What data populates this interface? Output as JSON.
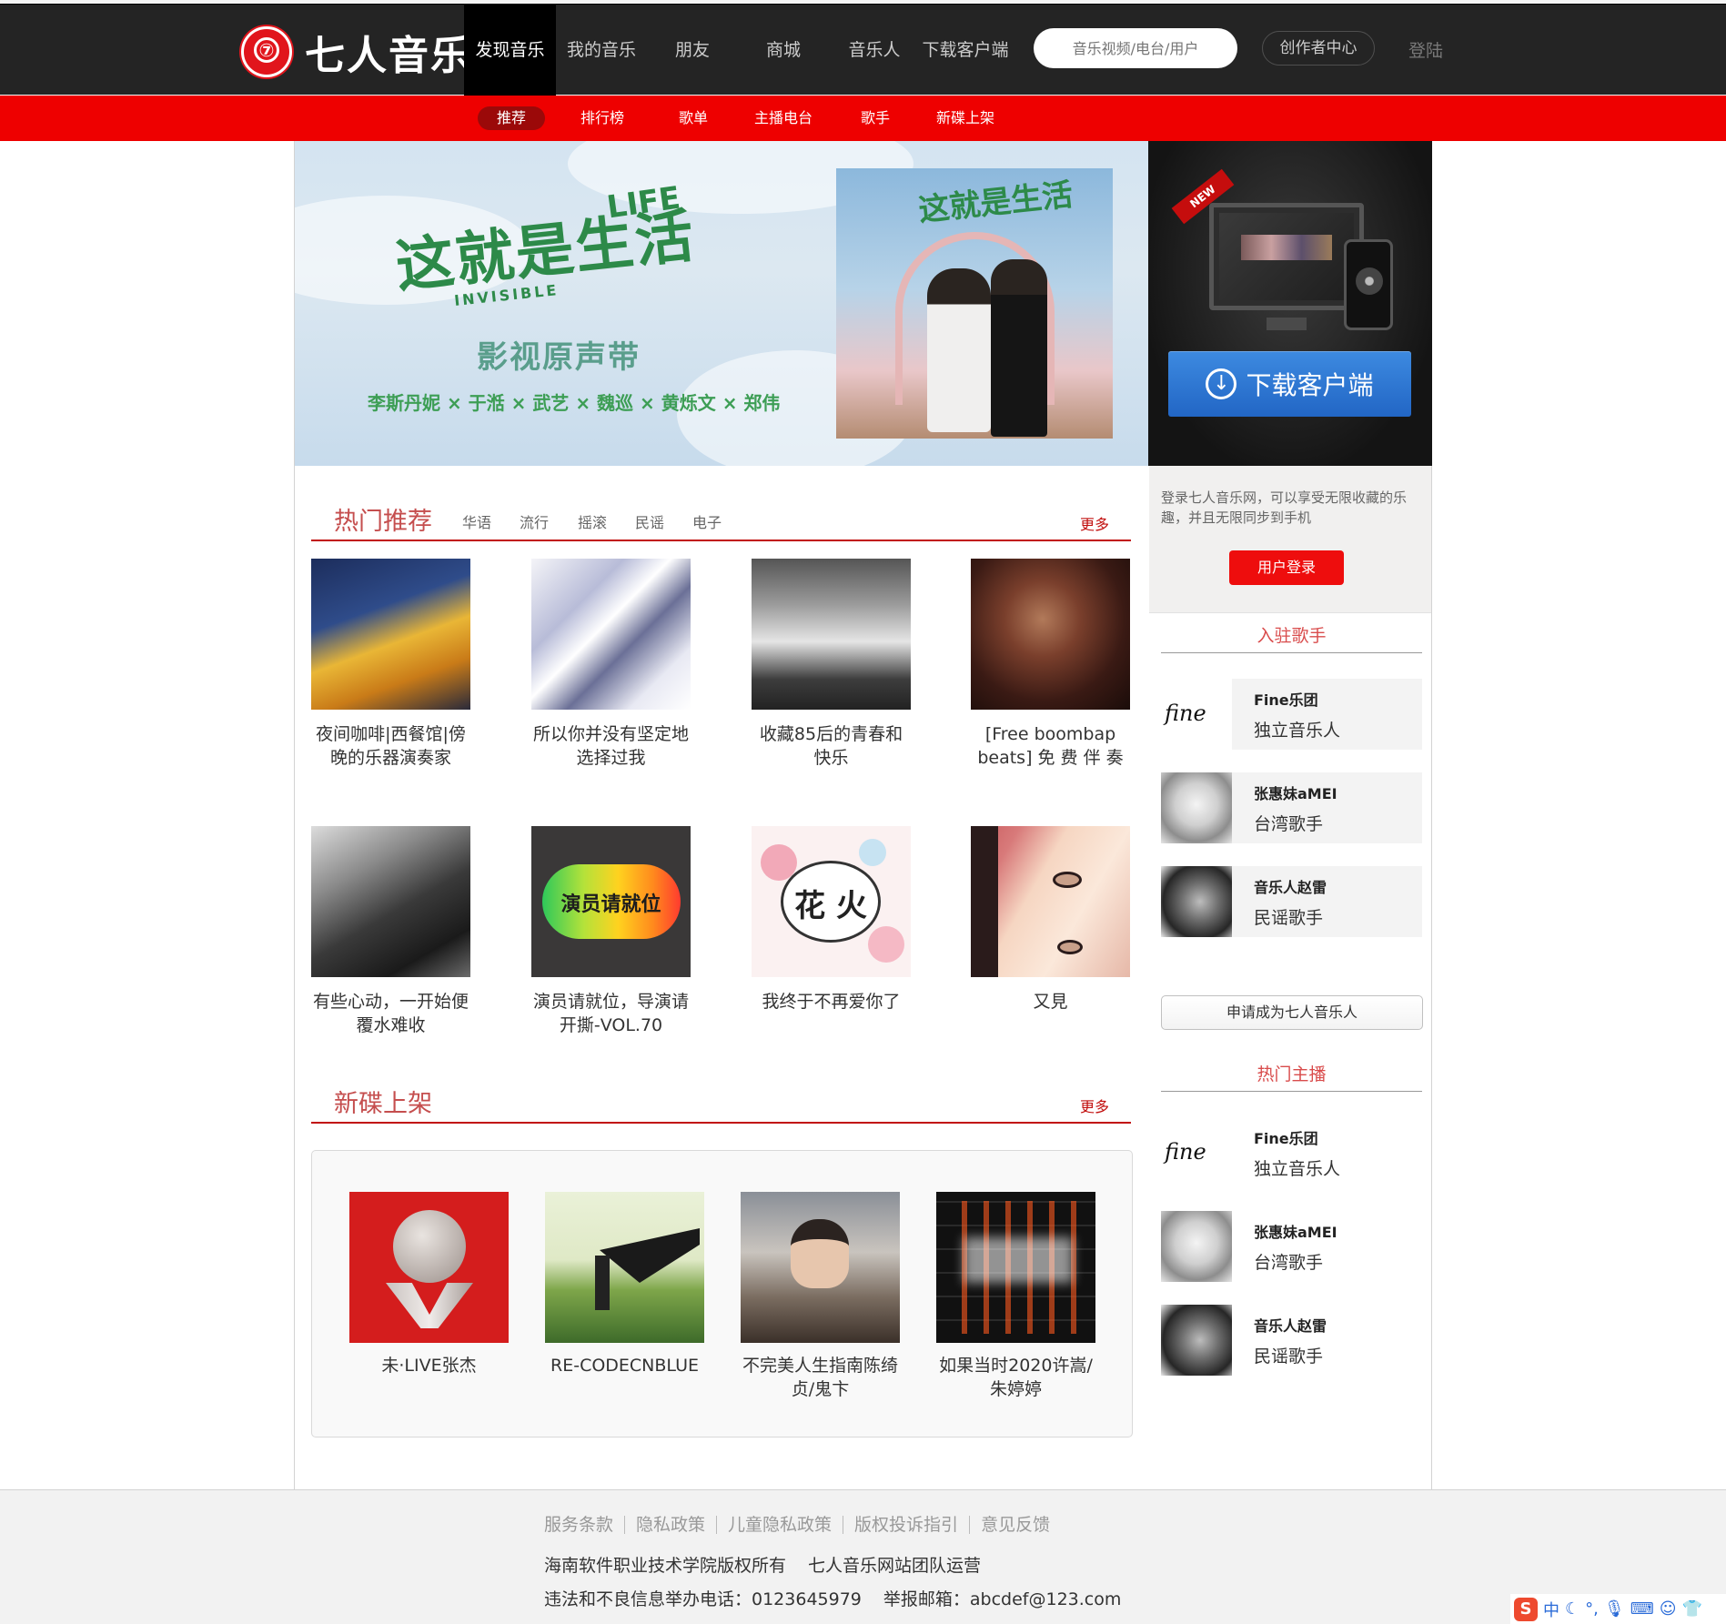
{
  "header": {
    "brand": "七人音乐",
    "logo_glyph": "⑦",
    "nav": [
      {
        "label": "发现音乐",
        "active": true
      },
      {
        "label": "我的音乐"
      },
      {
        "label": "朋友"
      },
      {
        "label": "商城"
      },
      {
        "label": "音乐人"
      },
      {
        "label": "下载客户端"
      }
    ],
    "search_placeholder": "音乐视频/电台/用户",
    "creator_label": "创作者中心",
    "login_label": "登陆"
  },
  "subnav": [
    "推荐",
    "排行榜",
    "歌单",
    "主播电台",
    "歌手",
    "新碟上架"
  ],
  "banner": {
    "title": "这就是生活",
    "title_en": "LIFE",
    "subtitle_en": "INVISIBLE",
    "tagline": "影视原声带",
    "cast": "李斯丹妮 × 于湉 × 武艺 × 魏巡 × 黄烁文 × 郑伟"
  },
  "download": {
    "badge": "NEW",
    "button_label": "下载客户端"
  },
  "hot": {
    "title": "热门推荐",
    "tags": [
      "华语",
      "流行",
      "摇滚",
      "民谣",
      "电子"
    ],
    "more": "更多",
    "items": [
      "夜间咖啡|西餐馆|傍晚的乐器演奏家",
      "所以你并没有坚定地选择过我",
      "收藏85后的青春和快乐",
      "[Free boombap beats] 免 费 伴 奏",
      "有些心动，一开始便覆水难收",
      "演员请就位，导演请开撕-VOL.70",
      "我终于不再爱你了",
      "又見"
    ],
    "cover_texts": [
      "演员请就位",
      "花 火"
    ]
  },
  "new_albums": {
    "title": "新碟上架",
    "more": "更多",
    "items": [
      "未·LIVE张杰",
      "RE-CODECNBLUE",
      "不完美人生指南陈绮贞/鬼卞",
      "如果当时2020许嵩/朱婷婷"
    ]
  },
  "sidebar": {
    "login_text": "登录七人音乐网，可以享受无限收藏的乐趣，并且无限同步到手机",
    "login_button": "用户登录",
    "singers_title": "入驻歌手",
    "singers": [
      {
        "name": "Fine乐团",
        "desc": "独立音乐人"
      },
      {
        "name": "张惠妹aMEI",
        "desc": "台湾歌手"
      },
      {
        "name": "音乐人赵雷",
        "desc": "民谣歌手"
      }
    ],
    "apply_button": "申请成为七人音乐人",
    "hosts_title": "热门主播",
    "hosts": [
      {
        "name": "Fine乐团",
        "desc": "独立音乐人"
      },
      {
        "name": "张惠妹aMEI",
        "desc": "台湾歌手"
      },
      {
        "name": "音乐人赵雷",
        "desc": "民谣歌手"
      }
    ],
    "fine_logo_text": "fine"
  },
  "footer": {
    "links": [
      "服务条款",
      "隐私政策",
      "儿童隐私政策",
      "版权投诉指引",
      "意见反馈"
    ],
    "copyright": "海南软件职业技术学院版权所有",
    "operator": "七人音乐网站团队运营",
    "report_phone": "违法和不良信息举办电话：0123645979",
    "report_email": "举报邮箱：abcdef@123.com"
  },
  "ime": {
    "logo": "S",
    "mode": "中"
  }
}
